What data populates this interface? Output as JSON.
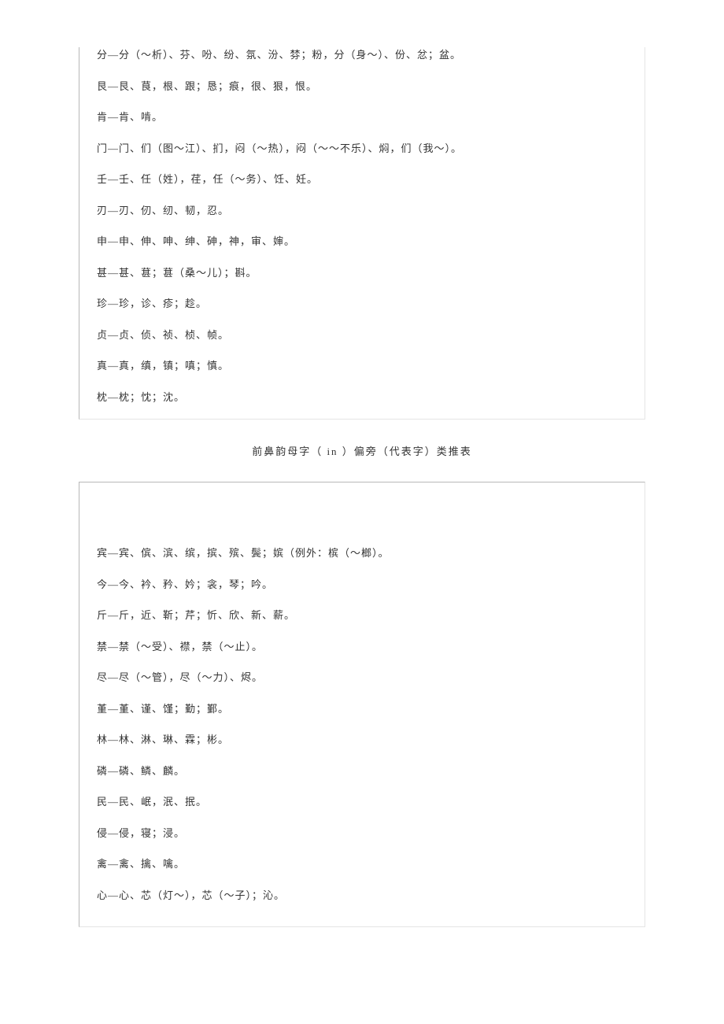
{
  "box1": {
    "lines": [
      "分—分（～析）、芬、吩、纷、氛、汾、棼；粉，分（身～）、份、忿；盆。",
      "艮—艮、茛，根、跟；恳；痕，很、狠，恨。",
      "肯—肯、啃。",
      "门—门、们（图～江）、扪，闷（～热），闷（～～不乐）、焖，们（我～）。",
      "壬—壬、任（姓），荏，任（～务）、饪、妊。",
      "刃—刃、仞、纫、韧，忍。",
      "申—申、伸、呻、绅、砷，神，审、婶。",
      "甚—甚、葚；葚（桑～儿）；斟。",
      "珍—珍，诊、疹；趁。",
      "贞—贞、侦、祯、桢、帧。",
      "真—真，缜，镇；嗔；慎。",
      "枕—枕；忱；沈。"
    ]
  },
  "section_title": "前鼻韵母字（ in ）偏旁（代表字）类推表",
  "box2": {
    "lines": [
      "宾—宾、傧、滨、缤，摈、殡、鬓；嫔（例外：槟（～榔）。",
      "今—今、衿、矜、妗；衾，琴；吟。",
      "斤—斤，近、靳；芹；忻、欣、新、薪。",
      "禁—禁（～受）、襟，禁（～止）。",
      "尽—尽（～管），尽（～力）、烬。",
      "堇—堇、谨、馑；勤；鄞。",
      "林—林、淋、琳、霖；彬。",
      "磷—磷、鳞、麟。",
      "民—民、岷，泯、抿。",
      "侵—侵，寝；浸。",
      "禽—禽、擒、噙。",
      "心—心、芯（灯～），芯（～子）；沁。"
    ]
  }
}
